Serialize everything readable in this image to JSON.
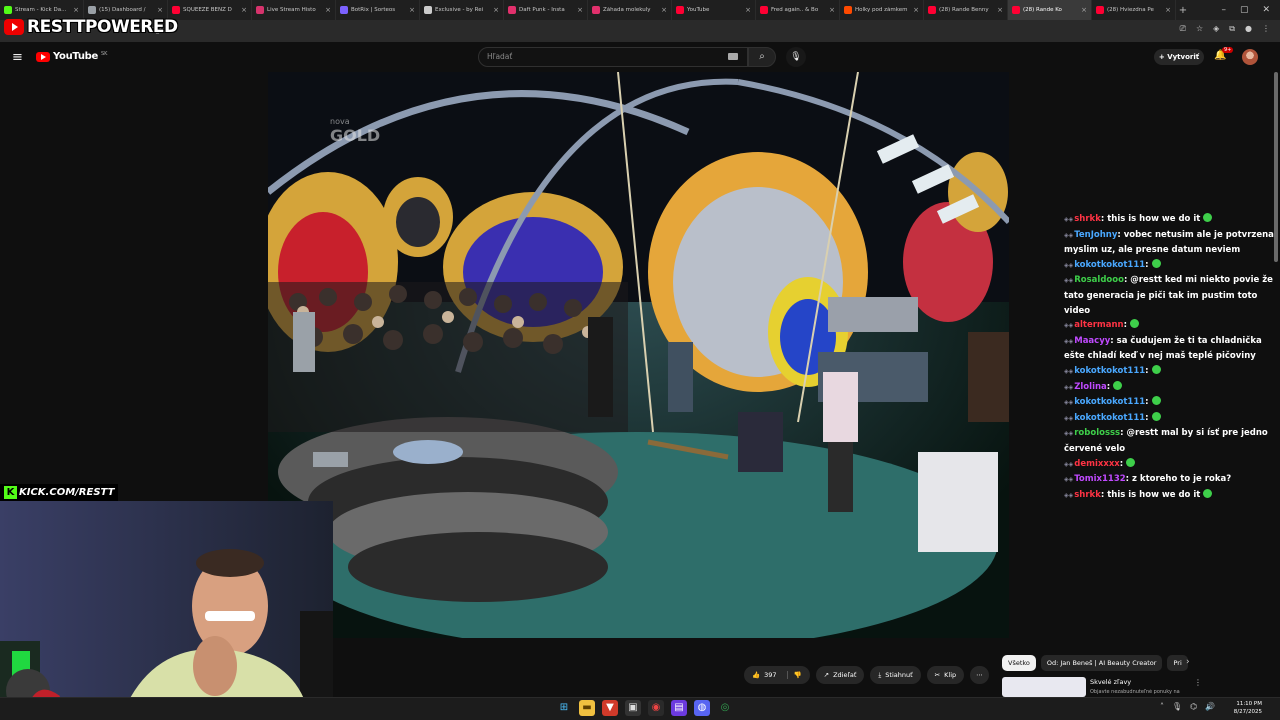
{
  "browser": {
    "tabs": [
      {
        "title": "Stream - Kick Da...",
        "favicon_color": "#53fc18",
        "active": false
      },
      {
        "title": "(15) Dashboard /",
        "favicon_color": "#9aa0a6",
        "active": false
      },
      {
        "title": "SQUEEZE BENZ D",
        "favicon_color": "#ff0033",
        "active": false
      },
      {
        "title": "Live Stream Histo",
        "favicon_color": "#d6336c",
        "active": false
      },
      {
        "title": "BotRix | Sorteos",
        "favicon_color": "#7b61ff",
        "active": false
      },
      {
        "title": "Exclusive - by Rei",
        "favicon_color": "#cccccc",
        "active": false
      },
      {
        "title": "Daft Punk - Insta",
        "favicon_color": "#e1306c",
        "active": false
      },
      {
        "title": "Záhada molekuly",
        "favicon_color": "#e1306c",
        "active": false
      },
      {
        "title": "YouTube",
        "favicon_color": "#ff0033",
        "active": false
      },
      {
        "title": "Fred again.. & Bo",
        "favicon_color": "#ff0033",
        "active": false
      },
      {
        "title": "Holky pod zámkem",
        "favicon_color": "#ff4a00",
        "active": false
      },
      {
        "title": "(28) Rande Benny",
        "favicon_color": "#ff0033",
        "active": false
      },
      {
        "title": "(28) Rande Ko",
        "favicon_color": "#ff0033",
        "active": true
      },
      {
        "title": "(28) Hviezdna Pe",
        "favicon_color": "#ff0033",
        "active": false
      }
    ],
    "url": "E-_6u4"
  },
  "youtube": {
    "logo_text": "YouTube",
    "country_code": "SK",
    "search_placeholder": "Hľadať",
    "create_label": "Vytvoriť",
    "notification_count": "9+"
  },
  "video": {
    "watermark_small": "nova",
    "watermark_big": "GOLD"
  },
  "overlay": {
    "brand": "RESTTPOWERED",
    "kick_url": "KICK.COM/RESTT"
  },
  "chat": [
    {
      "user": "shrkk",
      "color": "#ff3344",
      "text": "this is how we do it",
      "emote": true
    },
    {
      "user": "TenJohny",
      "color": "#4aa8ff",
      "text": "vobec netusim ale je potvrzena myslim uz, ale presne datum neviem",
      "emote": false
    },
    {
      "user": "kokotkokot111",
      "color": "#4aa8ff",
      "text": "",
      "emote": true
    },
    {
      "user": "Rosaldooo",
      "color": "#3ecf4a",
      "text": "@restt ked mi niekto povie že tato generacia je piči tak im pustim toto video",
      "emote": false
    },
    {
      "user": "altermann",
      "color": "#ff3344",
      "text": "",
      "emote": true
    },
    {
      "user": "Maacyy",
      "color": "#c04aff",
      "text": "sa čudujem že ti ta chladnička ešte chladí keď v nej maš teplé pičoviny",
      "emote": false
    },
    {
      "user": "kokotkokot111",
      "color": "#4aa8ff",
      "text": "",
      "emote": true
    },
    {
      "user": "Zlolina",
      "color": "#c04aff",
      "text": "",
      "emote": true
    },
    {
      "user": "kokotkokot111",
      "color": "#4aa8ff",
      "text": "",
      "emote": true
    },
    {
      "user": "kokotkokot111",
      "color": "#4aa8ff",
      "text": "",
      "emote": true
    },
    {
      "user": "robolosss",
      "color": "#3ecf4a",
      "text": "@restt mal by si ísť pre jedno červené velo",
      "emote": false
    },
    {
      "user": "demixxxx",
      "color": "#ff3344",
      "text": "",
      "emote": true
    },
    {
      "user": "Tomix1132",
      "color": "#c04aff",
      "text": "z ktoreho to je roka?",
      "emote": false
    },
    {
      "user": "shrkk",
      "color": "#ff3344",
      "text": "this is how we do it",
      "emote": true
    }
  ],
  "actions": {
    "likes": "397",
    "share": "Zdieľať",
    "download": "Stiahnuť",
    "clip": "Klip"
  },
  "chips": [
    "Všetko",
    "Od: Jan Beneš | AI Beauty Creator",
    "Pri"
  ],
  "recommendation": {
    "title": "Skvelé zľavy",
    "subtitle": "Objavte nezabudnuteľné ponuky na"
  },
  "taskbar": {
    "time": "11:10 PM",
    "date": "8/27/2025"
  }
}
